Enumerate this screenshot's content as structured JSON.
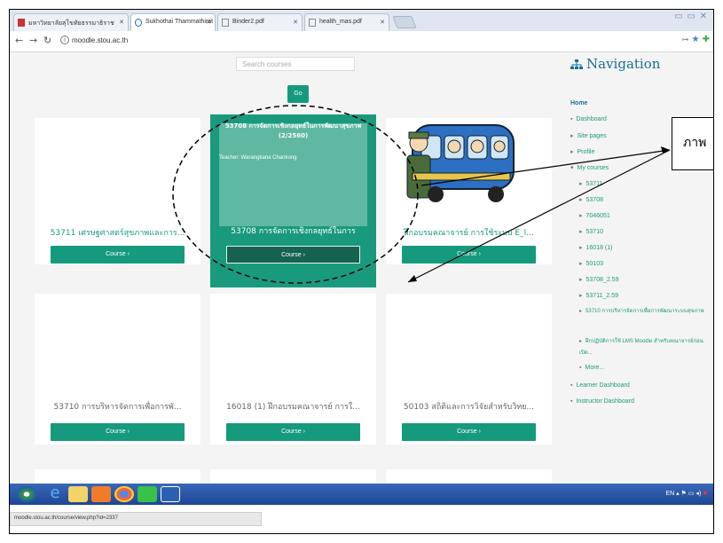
{
  "browser": {
    "tabs": [
      {
        "label": "มหาวิทยาลัยสุโขทัยธรรมาธิราช"
      },
      {
        "label": "Sukhothai Thammathirat"
      },
      {
        "label": "Binder2.pdf"
      },
      {
        "label": "health_mas.pdf"
      }
    ],
    "url": "moodle.stou.ac.th",
    "status_url": "moodle.stou.ac.th/course/view.php?id=2337"
  },
  "search": {
    "placeholder": "Search courses",
    "go_label": "Go"
  },
  "courses": [
    {
      "title": "53711 เศรษฐศาสตร์สุขภาพและการ...",
      "button": "Course ›"
    },
    {
      "title": "53708 การจัดการเชิงกลยุทธ์ในการ",
      "button": "Course ›",
      "hover_title": "53708 การจัดการเชิงกลยุทธ์ในการพัฒนาสุขภาพ (2/2560)",
      "teacher": "Teacher: Warangkana Chankong"
    },
    {
      "title": "ฝึกอบรมคณาจารย์ การใช้ระบบ E_l...",
      "button": "Course ›"
    },
    {
      "title": "53710 การบริหารจัดการเพื่อการพั...",
      "button": "Course ›"
    },
    {
      "title": "16018 (1) ฝึกอบรมคณาจารย์ การใ...",
      "button": "Course ›"
    },
    {
      "title": "50103 สถิติและการวิจัยสำหรับวิทย...",
      "button": "Course ›"
    }
  ],
  "navigation": {
    "title": "Navigation",
    "home": "Home",
    "items": [
      "Dashboard",
      "Site pages",
      "Profile",
      "My courses"
    ],
    "my_courses": [
      "53711",
      "53708",
      "7046051",
      "53710",
      "16018 (1)",
      "50103",
      "53708_2.59",
      "53711_2.59",
      "53710 การบริหารจัดการเพื่อการพัฒนาระบบสุขภาพ",
      "ฝึกปฏิบัติการใช้ LMS Moodle สำหรับคณาจารย์ก่อนเปิด..."
    ],
    "more": "More...",
    "learner_dashboard": "Learner Dashboard",
    "instructor_dashboard": "Instructor Dashboard"
  },
  "taskbar": {
    "tray": "EN"
  },
  "callout": {
    "text": "ภาพ"
  },
  "colors": {
    "accent": "#169a7d",
    "nav_title": "#1a6e97"
  }
}
